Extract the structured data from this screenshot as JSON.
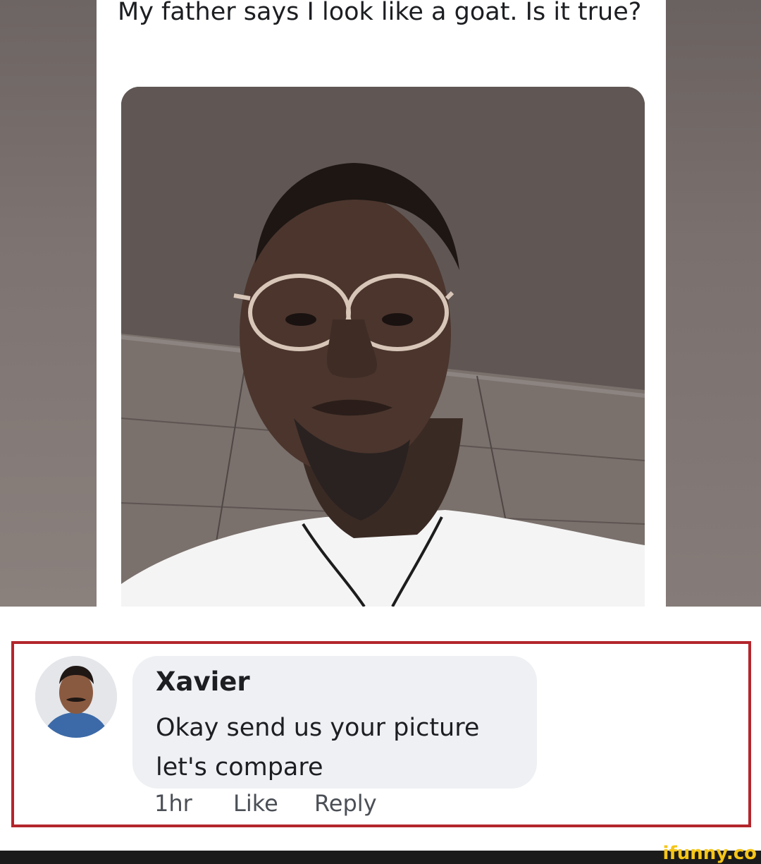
{
  "post": {
    "text": "My father says I look like a goat. Is it true?"
  },
  "comment": {
    "author": "Xavier",
    "text": "Okay send us your picture let's compare",
    "time": "1hr",
    "like_label": "Like",
    "reply_label": "Reply"
  },
  "watermark": "ifunny.co",
  "colors": {
    "highlight_border": "#b3262c",
    "bubble": "#eef0f3",
    "watermark": "#f5c518"
  }
}
